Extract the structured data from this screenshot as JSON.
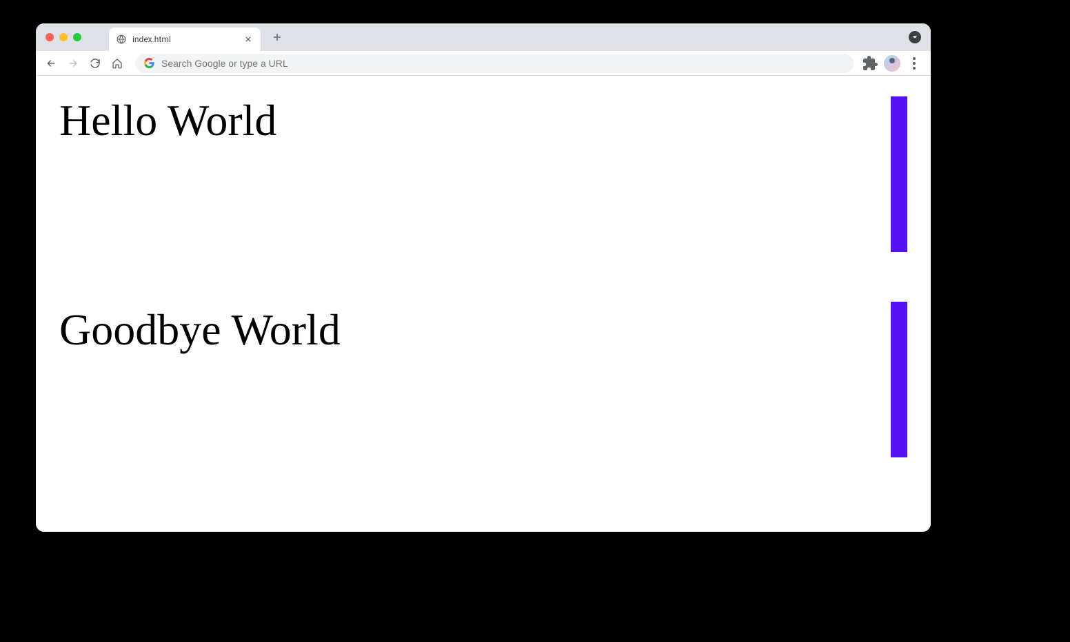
{
  "browser": {
    "tab": {
      "title": "index.html"
    },
    "addressbar": {
      "placeholder": "Search Google or type a URL"
    }
  },
  "page": {
    "heading1": "Hello World",
    "heading2": "Goodbye World",
    "accent_color": "#5510f4"
  }
}
